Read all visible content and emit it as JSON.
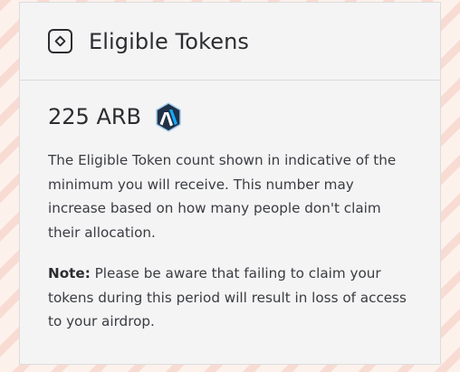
{
  "card": {
    "title": "Eligible Tokens",
    "title_icon": "diamond-square-icon",
    "amount": "225 ARB",
    "token_icon": "arbitrum-logo-icon",
    "description": "The Eligible Token count shown in indicative of the minimum you will receive. This number may increase based on how many people don't claim their allocation.",
    "note_label": "Note:",
    "note_text": " Please be aware that failing to claim your tokens during this period will result in loss of access to your airdrop."
  },
  "colors": {
    "page_background": "#fdf1ec",
    "card_background": "#f4f4f4",
    "text": "#2c2d31",
    "arbitrum_dark": "#213147",
    "arbitrum_blue": "#12aaff"
  }
}
